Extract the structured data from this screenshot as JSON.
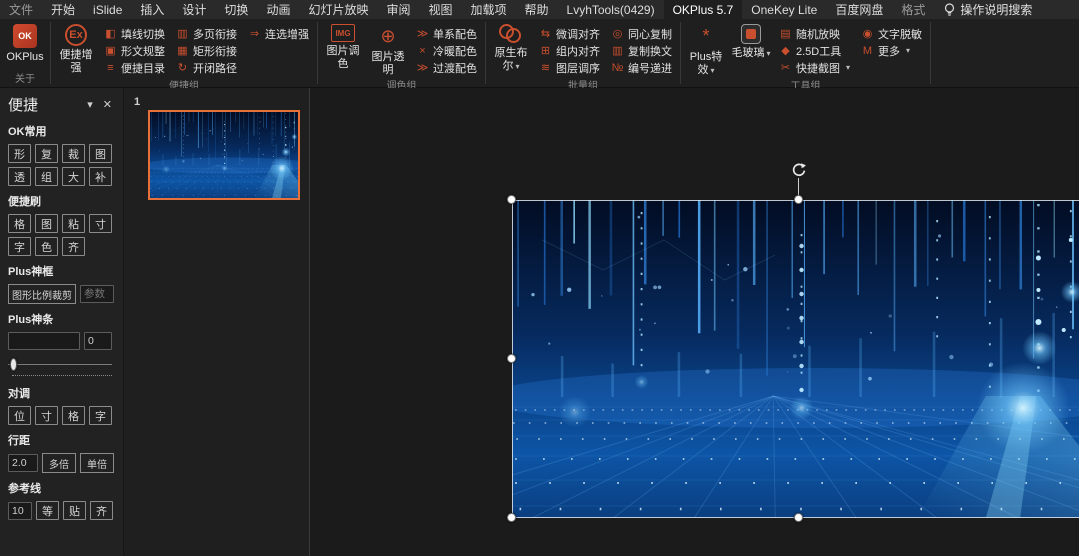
{
  "colors": {
    "accent": "#c94f2e",
    "selection": "#e8713a",
    "ribbon_bg": "#1f1f1f",
    "menubar_bg": "#2a2a2a"
  },
  "menubar": {
    "items": [
      {
        "label": "文件"
      },
      {
        "label": "开始"
      },
      {
        "label": "iSlide"
      },
      {
        "label": "插入"
      },
      {
        "label": "设计"
      },
      {
        "label": "切换"
      },
      {
        "label": "动画"
      },
      {
        "label": "幻灯片放映"
      },
      {
        "label": "审阅"
      },
      {
        "label": "视图"
      },
      {
        "label": "加载项"
      },
      {
        "label": "帮助"
      },
      {
        "label": "LvyhTools(0429)"
      },
      {
        "label": "OKPlus 5.7"
      },
      {
        "label": "OneKey Lite"
      },
      {
        "label": "百度网盘"
      },
      {
        "label": "格式"
      }
    ],
    "active_item": "OKPlus 5.7",
    "search_label": "操作说明搜索"
  },
  "ribbon": {
    "about": {
      "big_label": "OKPlus",
      "logo_text": "OK",
      "group_label": "关于"
    },
    "convenient": {
      "big_label": "便捷增强",
      "big_icon_text": "Ex",
      "items": [
        {
          "label": "填线切换"
        },
        {
          "label": "形文规整"
        },
        {
          "label": "便捷目录"
        },
        {
          "label": "多页衔接"
        },
        {
          "label": "矩形衔接"
        },
        {
          "label": "开闭路径"
        },
        {
          "label": "连选增强"
        }
      ],
      "group_label": "便捷组"
    },
    "color": {
      "big1_label": "图片调色",
      "big1_icon_text": "IMG",
      "big2_label": "图片透明",
      "items": [
        {
          "label": "单系配色"
        },
        {
          "label": "冷暖配色"
        },
        {
          "label": "过渡配色"
        }
      ],
      "group_label": "调色组"
    },
    "batch": {
      "big_label": "原生布尔",
      "items": [
        {
          "label": "微调对齐"
        },
        {
          "label": "组内对齐"
        },
        {
          "label": "图层调序"
        },
        {
          "label": "同心复制"
        },
        {
          "label": "复制换文"
        },
        {
          "label": "编号递进"
        }
      ],
      "group_label": "批量组"
    },
    "tools": {
      "big1_label": "Plus特效",
      "big2_label": "毛玻璃",
      "more_icon_text": "M",
      "items": [
        {
          "label": "随机放映"
        },
        {
          "label": "2.5D工具"
        },
        {
          "label": "快捷截图"
        },
        {
          "label": "文字脱敏"
        },
        {
          "label": "更多"
        }
      ],
      "group_label": "工具组"
    }
  },
  "sidebar": {
    "title": "便捷",
    "ok_common": {
      "label": "OK常用",
      "buttons": [
        "形",
        "复",
        "裁",
        "图",
        "透",
        "组",
        "大",
        "补"
      ]
    },
    "brush": {
      "label": "便捷刷",
      "buttons": [
        "格",
        "图",
        "粘",
        "寸",
        "字",
        "色",
        "齐"
      ]
    },
    "magic_frame": {
      "label": "Plus神框",
      "crop_button": "图形比例裁剪",
      "param_placeholder": "参数"
    },
    "magic_bar": {
      "label": "Plus神条",
      "input_value": "",
      "small_value": "0"
    },
    "swap": {
      "label": "对调",
      "buttons": [
        "位",
        "寸",
        "格",
        "字"
      ]
    },
    "line_spacing": {
      "label": "行距",
      "value": "2.0",
      "buttons": [
        "多倍",
        "单倍"
      ]
    },
    "guides": {
      "label": "参考线",
      "value": "10",
      "buttons": [
        "等",
        "贴",
        "齐"
      ]
    }
  },
  "slides_panel": {
    "slide_number": "1"
  }
}
